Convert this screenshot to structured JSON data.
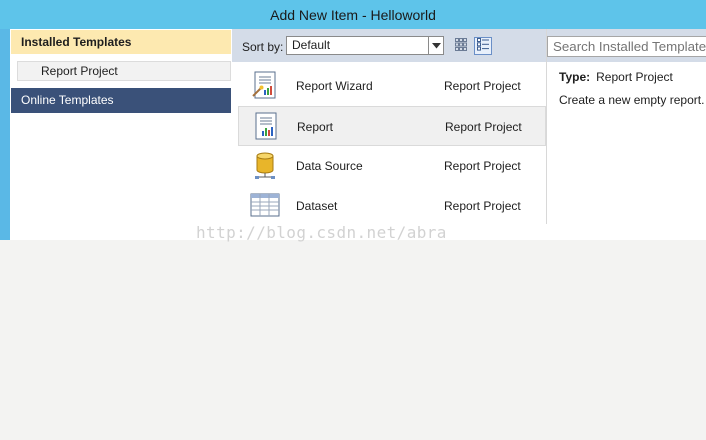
{
  "window": {
    "title": "Add New Item - Helloworld"
  },
  "left_pane": {
    "installed_header": "Installed Templates",
    "tree_items": [
      {
        "label": "Report Project"
      }
    ],
    "online_header": "Online Templates"
  },
  "sort_bar": {
    "label": "Sort by:",
    "selected": "Default",
    "view_buttons": [
      "small-icons-view",
      "medium-icons-view"
    ]
  },
  "templates": [
    {
      "name": "Report Wizard",
      "type": "Report Project",
      "icon": "report-wizard-icon",
      "selected": false
    },
    {
      "name": "Report",
      "type": "Report Project",
      "icon": "report-icon",
      "selected": true
    },
    {
      "name": "Data Source",
      "type": "Report Project",
      "icon": "data-source-icon",
      "selected": false
    },
    {
      "name": "Dataset",
      "type": "Report Project",
      "icon": "dataset-icon",
      "selected": false
    }
  ],
  "details": {
    "search_placeholder": "Search Installed Templates",
    "type_label": "Type:",
    "type_value": "Report Project",
    "description": "Create a new empty report."
  },
  "watermark": "http://blog.csdn.net/abra",
  "colors": {
    "title_bar": "#5ec4ea",
    "installed_header": "#fde9b0",
    "online_header": "#3a5179",
    "toolbar": "#d4dce8"
  }
}
